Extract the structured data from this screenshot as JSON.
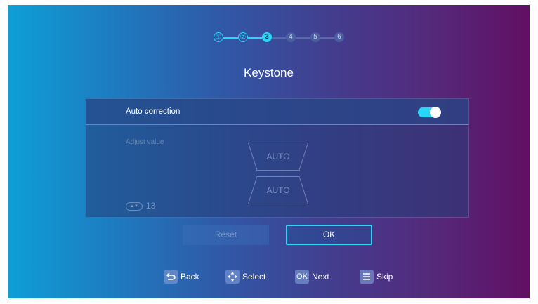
{
  "colors": {
    "accent": "#29d6f5",
    "background_left": "#0e9fd6",
    "background_right": "#620f62"
  },
  "stepper": {
    "steps": [
      {
        "label": "①",
        "state": "done"
      },
      {
        "label": "②",
        "state": "done"
      },
      {
        "label": "3",
        "state": "current"
      },
      {
        "label": "4",
        "state": "todo"
      },
      {
        "label": "5",
        "state": "todo"
      },
      {
        "label": "6",
        "state": "todo"
      }
    ]
  },
  "title": "Keystone",
  "panel": {
    "auto_correction": {
      "label": "Auto correction",
      "enabled": true
    },
    "adjust_label": "Adjust value",
    "auto_top": "AUTO",
    "auto_bottom": "AUTO",
    "value": "13",
    "value_icon": "up-down-icon"
  },
  "buttons": {
    "reset": "Reset",
    "ok": "OK"
  },
  "hints": {
    "back": {
      "icon": "back-icon",
      "label": "Back"
    },
    "select": {
      "icon": "dpad-icon",
      "label": "Select"
    },
    "next": {
      "icon": "ok-key-icon",
      "key": "OK",
      "label": "Next"
    },
    "skip": {
      "icon": "menu-icon",
      "label": "Skip"
    }
  }
}
